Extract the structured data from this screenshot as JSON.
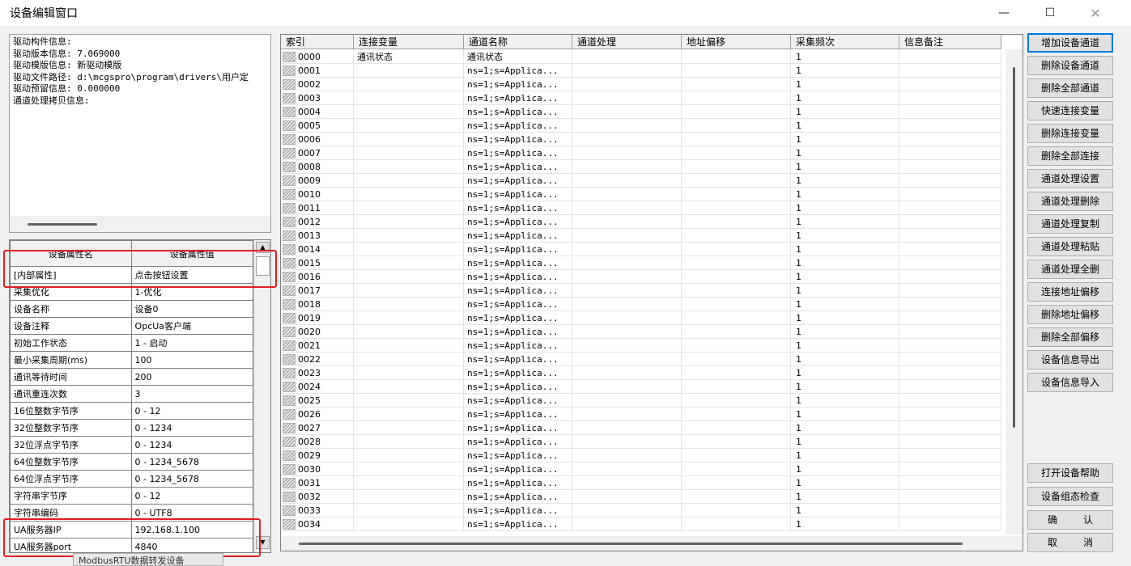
{
  "window": {
    "title": "设备编辑窗口",
    "min_glyph": "—",
    "max_glyph": "☐",
    "close_glyph": "✕"
  },
  "info_lines": [
    "驱动构件信息:",
    "驱动版本信息: 7.069000",
    "驱动模版信息: 新驱动模版",
    "驱动文件路径: d:\\mcgspro\\program\\drivers\\用户定",
    "驱动预留信息: 0.000000",
    "通道处理拷贝信息:"
  ],
  "props": {
    "headers": [
      "设备属性名",
      "设备属性值"
    ],
    "rows": [
      [
        "[内部属性]",
        "点击按钮设置"
      ],
      [
        "采集优化",
        "1-优化"
      ],
      [
        "设备名称",
        "设备0"
      ],
      [
        "设备注释",
        "OpcUa客户端"
      ],
      [
        "初始工作状态",
        "1 - 启动"
      ],
      [
        "最小采集周期(ms)",
        "100"
      ],
      [
        "通讯等待时间",
        "200"
      ],
      [
        "通讯重连次数",
        "3"
      ],
      [
        "16位整数字节序",
        "0 - 12"
      ],
      [
        "32位整数字节序",
        "0 - 1234"
      ],
      [
        "32位浮点字节序",
        "0 - 1234"
      ],
      [
        "64位整数字节序",
        "0 - 1234_5678"
      ],
      [
        "64位浮点字节序",
        "0 - 1234_5678"
      ],
      [
        "字符串字节序",
        "0 - 12"
      ],
      [
        "字符串编码",
        "0 - UTF8"
      ],
      [
        "UA服务器IP",
        "192.168.1.100"
      ],
      [
        "UA服务器port",
        "4840"
      ]
    ]
  },
  "bottom_tab": "ModbusRTU数据转发设备",
  "grid": {
    "headers": [
      "索引",
      "连接变量",
      "通道名称",
      "通道处理",
      "地址偏移",
      "采集频次",
      "信息备注"
    ],
    "rows": [
      [
        "0000",
        "通讯状态",
        "通讯状态",
        "",
        "",
        "1",
        ""
      ],
      [
        "0001",
        "",
        "ns=1;s=Applica...",
        "",
        "",
        "1",
        ""
      ],
      [
        "0002",
        "",
        "ns=1;s=Applica...",
        "",
        "",
        "1",
        ""
      ],
      [
        "0003",
        "",
        "ns=1;s=Applica...",
        "",
        "",
        "1",
        ""
      ],
      [
        "0004",
        "",
        "ns=1;s=Applica...",
        "",
        "",
        "1",
        ""
      ],
      [
        "0005",
        "",
        "ns=1;s=Applica...",
        "",
        "",
        "1",
        ""
      ],
      [
        "0006",
        "",
        "ns=1;s=Applica...",
        "",
        "",
        "1",
        ""
      ],
      [
        "0007",
        "",
        "ns=1;s=Applica...",
        "",
        "",
        "1",
        ""
      ],
      [
        "0008",
        "",
        "ns=1;s=Applica...",
        "",
        "",
        "1",
        ""
      ],
      [
        "0009",
        "",
        "ns=1;s=Applica...",
        "",
        "",
        "1",
        ""
      ],
      [
        "0010",
        "",
        "ns=1;s=Applica...",
        "",
        "",
        "1",
        ""
      ],
      [
        "0011",
        "",
        "ns=1;s=Applica...",
        "",
        "",
        "1",
        ""
      ],
      [
        "0012",
        "",
        "ns=1;s=Applica...",
        "",
        "",
        "1",
        ""
      ],
      [
        "0013",
        "",
        "ns=1;s=Applica...",
        "",
        "",
        "1",
        ""
      ],
      [
        "0014",
        "",
        "ns=1;s=Applica...",
        "",
        "",
        "1",
        ""
      ],
      [
        "0015",
        "",
        "ns=1;s=Applica...",
        "",
        "",
        "1",
        ""
      ],
      [
        "0016",
        "",
        "ns=1;s=Applica...",
        "",
        "",
        "1",
        ""
      ],
      [
        "0017",
        "",
        "ns=1;s=Applica...",
        "",
        "",
        "1",
        ""
      ],
      [
        "0018",
        "",
        "ns=1;s=Applica...",
        "",
        "",
        "1",
        ""
      ],
      [
        "0019",
        "",
        "ns=1;s=Applica...",
        "",
        "",
        "1",
        ""
      ],
      [
        "0020",
        "",
        "ns=1;s=Applica...",
        "",
        "",
        "1",
        ""
      ],
      [
        "0021",
        "",
        "ns=1;s=Applica...",
        "",
        "",
        "1",
        ""
      ],
      [
        "0022",
        "",
        "ns=1;s=Applica...",
        "",
        "",
        "1",
        ""
      ],
      [
        "0023",
        "",
        "ns=1;s=Applica...",
        "",
        "",
        "1",
        ""
      ],
      [
        "0024",
        "",
        "ns=1;s=Applica...",
        "",
        "",
        "1",
        ""
      ],
      [
        "0025",
        "",
        "ns=1;s=Applica...",
        "",
        "",
        "1",
        ""
      ],
      [
        "0026",
        "",
        "ns=1;s=Applica...",
        "",
        "",
        "1",
        ""
      ],
      [
        "0027",
        "",
        "ns=1;s=Applica...",
        "",
        "",
        "1",
        ""
      ],
      [
        "0028",
        "",
        "ns=1;s=Applica...",
        "",
        "",
        "1",
        ""
      ],
      [
        "0029",
        "",
        "ns=1;s=Applica...",
        "",
        "",
        "1",
        ""
      ],
      [
        "0030",
        "",
        "ns=1;s=Applica...",
        "",
        "",
        "1",
        ""
      ],
      [
        "0031",
        "",
        "ns=1;s=Applica...",
        "",
        "",
        "1",
        ""
      ],
      [
        "0032",
        "",
        "ns=1;s=Applica...",
        "",
        "",
        "1",
        ""
      ],
      [
        "0033",
        "",
        "ns=1;s=Applica...",
        "",
        "",
        "1",
        ""
      ],
      [
        "0034",
        "",
        "ns=1;s=Applica...",
        "",
        "",
        "1",
        ""
      ]
    ]
  },
  "buttons": {
    "add_channel": "增加设备通道",
    "delete_channel": "删除设备通道",
    "delete_all_channels": "删除全部通道",
    "quick_connect": "快速连接变量",
    "delete_connect": "删除连接变量",
    "delete_all_connect": "删除全部连接",
    "proc_settings": "通道处理设置",
    "proc_delete": "通道处理删除",
    "proc_copy": "通道处理复制",
    "proc_paste": "通道处理粘贴",
    "proc_delete_all": "通道处理全删",
    "addr_offset": "连接地址偏移",
    "delete_offset": "删除地址偏移",
    "delete_all_offset": "删除全部偏移",
    "export_info": "设备信息导出",
    "import_info": "设备信息导入",
    "open_help": "打开设备帮助",
    "config_check": "设备组态检查",
    "ok_1": "确",
    "ok_2": "认",
    "cancel_1": "取",
    "cancel_2": "消"
  }
}
